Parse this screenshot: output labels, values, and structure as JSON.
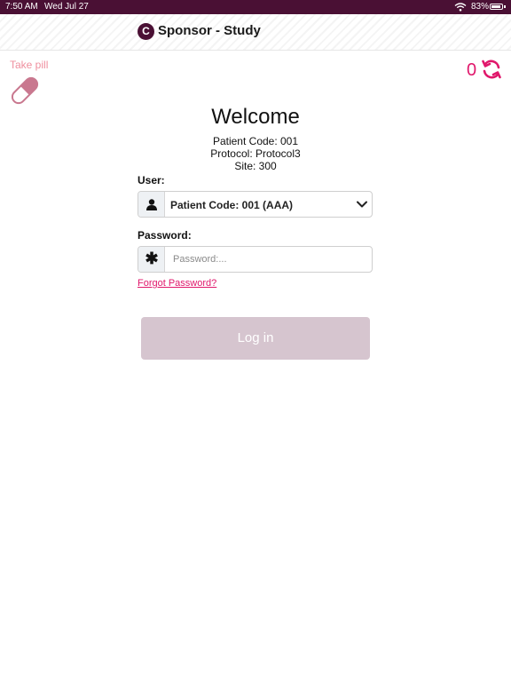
{
  "status_bar": {
    "time": "7:50 AM",
    "date": "Wed Jul 27",
    "battery_percent": "83%",
    "battery_level": 0.83
  },
  "header": {
    "logo_letter": "C",
    "title": "Sponsor - Study"
  },
  "take_pill": {
    "label": "Take pill",
    "icon": "pill-icon"
  },
  "sync": {
    "count": "0",
    "icon": "sync-icon"
  },
  "welcome": {
    "title": "Welcome",
    "patient_code": "Patient Code: 001",
    "protocol": "Protocol: Protocol3",
    "site": "Site: 300"
  },
  "form": {
    "user_label": "User:",
    "user_selected": "Patient Code: 001 (AAA)",
    "password_label": "Password:",
    "password_placeholder": "Password:...",
    "forgot_password": "Forgot Password?",
    "login_button": "Log in"
  },
  "colors": {
    "brand": "#4a1034",
    "accent": "#e0176b",
    "pill": "#c9788f",
    "login_disabled": "#d6c5cf"
  }
}
